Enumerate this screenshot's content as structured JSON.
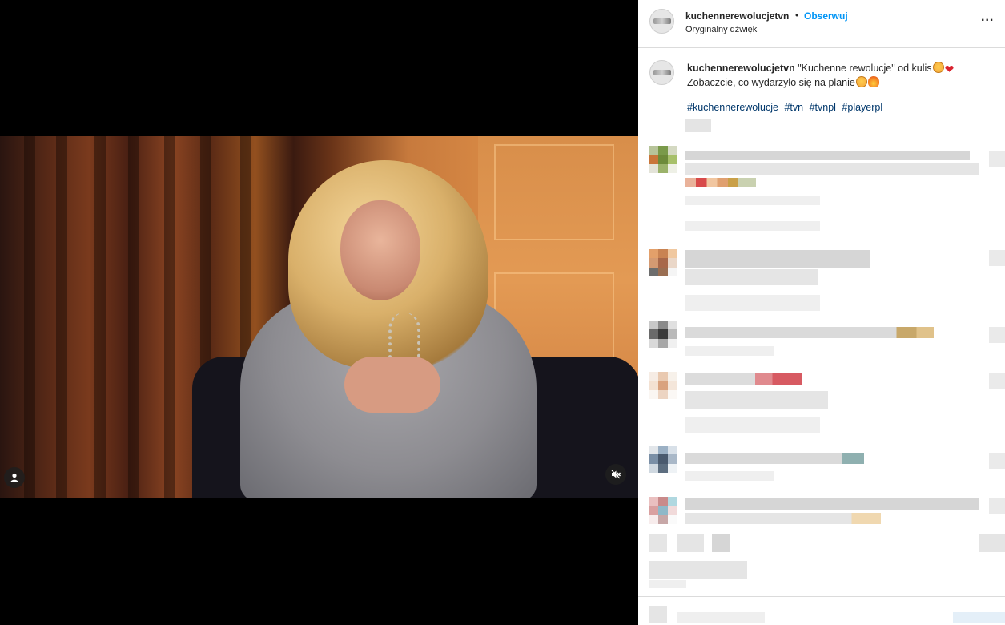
{
  "post": {
    "username": "kuchennerewolucjetvn",
    "follow_label": "Obserwuj",
    "separator": "•",
    "audio_label": "Oryginalny dźwięk",
    "more_label": "...",
    "caption_user": "kuchennerewolucjetvn",
    "caption_line1": "\"Kuchenne rewolucje\" od kulis",
    "caption_line2": "Zobaczcie, co wydarzyło się na planie",
    "hashtags": [
      "#kuchennerewolucje",
      "#tvn",
      "#tvnpl",
      "#playerpl"
    ]
  },
  "video": {
    "user_tag_icon": "user-icon",
    "mute_icon": "muted-speaker-icon"
  },
  "colors": {
    "follow_blue": "#0095f6",
    "hashtag_blue": "#00376b",
    "text": "#262626",
    "divider": "#dbdbdb"
  }
}
